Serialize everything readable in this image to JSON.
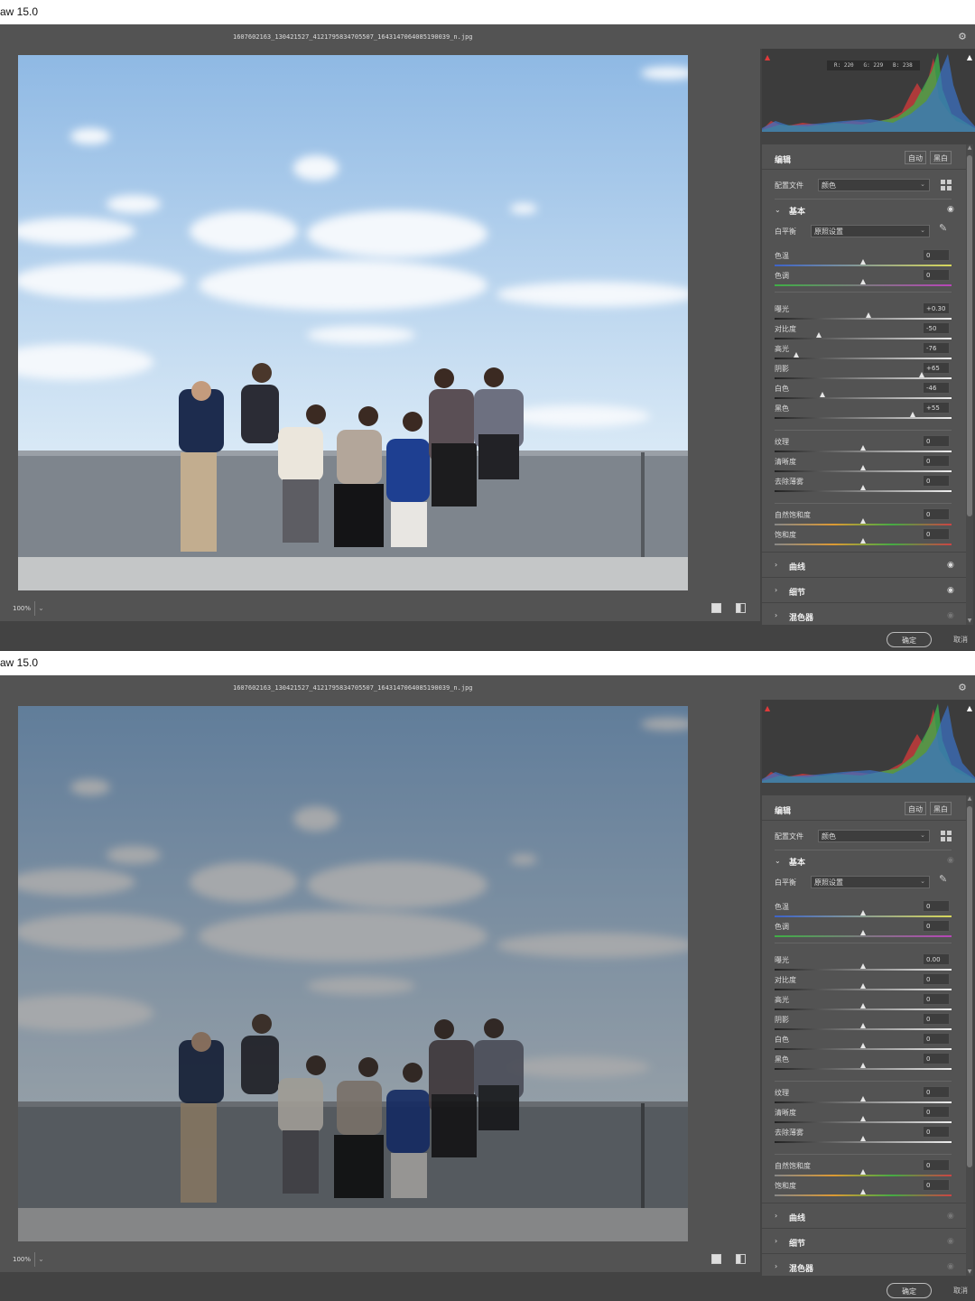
{
  "app": {
    "title": "aw 15.0",
    "filename": "1607602163_130421527_4121795834705507_1643147064085190039_n.jpg"
  },
  "toolbar": {
    "zoom": "100%",
    "settings_icon": "gear-icon"
  },
  "histogram": {
    "readout": "R: 220   G: 229   B: 238"
  },
  "panel": {
    "edit_label": "编辑",
    "auto_label": "自动",
    "bw_label": "黑白",
    "profile_label": "配置文件",
    "profile_value": "颜色",
    "basic_title": "基本",
    "wb_label": "白平衡",
    "wb_value": "原照设置"
  },
  "sections": {
    "curve": "曲线",
    "detail": "细节",
    "mixer": "混色器"
  },
  "footer": {
    "ok": "确定",
    "cancel": "取消"
  },
  "colors": {
    "bg": "#434343",
    "panel": "#535353",
    "accent_white": "#e6e6e6",
    "sky": "#a9c9e8"
  },
  "before": {
    "sliders": [
      {
        "label": "色温",
        "value": "0",
        "pos": 0.5
      },
      {
        "label": "色调",
        "value": "0",
        "pos": 0.5
      },
      {
        "label": "曝光",
        "value": "+0.30",
        "pos": 0.53
      },
      {
        "label": "对比度",
        "value": "-50",
        "pos": 0.25
      },
      {
        "label": "高光",
        "value": "-76",
        "pos": 0.12
      },
      {
        "label": "阴影",
        "value": "+65",
        "pos": 0.83
      },
      {
        "label": "白色",
        "value": "-46",
        "pos": 0.27
      },
      {
        "label": "黑色",
        "value": "+55",
        "pos": 0.78
      },
      {
        "label": "纹理",
        "value": "0",
        "pos": 0.5
      },
      {
        "label": "清晰度",
        "value": "0",
        "pos": 0.5
      },
      {
        "label": "去除薄雾",
        "value": "0",
        "pos": 0.5
      },
      {
        "label": "自然饱和度",
        "value": "0",
        "pos": 0.5
      },
      {
        "label": "饱和度",
        "value": "0",
        "pos": 0.5
      }
    ]
  },
  "after": {
    "sliders": [
      {
        "label": "色温",
        "value": "0",
        "pos": 0.5
      },
      {
        "label": "色调",
        "value": "0",
        "pos": 0.5
      },
      {
        "label": "曝光",
        "value": "0.00",
        "pos": 0.5
      },
      {
        "label": "对比度",
        "value": "0",
        "pos": 0.5
      },
      {
        "label": "高光",
        "value": "0",
        "pos": 0.5
      },
      {
        "label": "阴影",
        "value": "0",
        "pos": 0.5
      },
      {
        "label": "白色",
        "value": "0",
        "pos": 0.5
      },
      {
        "label": "黑色",
        "value": "0",
        "pos": 0.5
      },
      {
        "label": "纹理",
        "value": "0",
        "pos": 0.5
      },
      {
        "label": "清晰度",
        "value": "0",
        "pos": 0.5
      },
      {
        "label": "去除薄雾",
        "value": "0",
        "pos": 0.5
      },
      {
        "label": "自然饱和度",
        "value": "0",
        "pos": 0.5
      },
      {
        "label": "饱和度",
        "value": "0",
        "pos": 0.5
      }
    ]
  }
}
